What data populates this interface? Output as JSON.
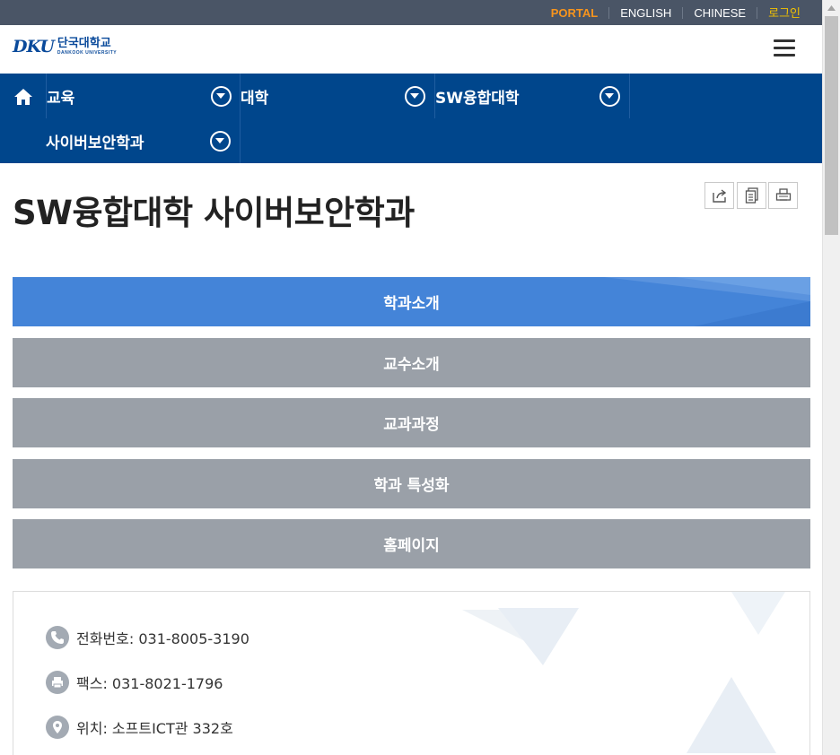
{
  "utility": {
    "portal": "PORTAL",
    "english": "ENGLISH",
    "chinese": "CHINESE",
    "login": "로그인"
  },
  "logo": {
    "mark": "DKU",
    "name_ko": "단국대학교",
    "name_en": "DANKOOK UNIVERSITY"
  },
  "nav": {
    "items": [
      {
        "label": "교육"
      },
      {
        "label": "대학"
      },
      {
        "label": "SW융합대학"
      },
      {
        "label": "사이버보안학과"
      }
    ]
  },
  "page": {
    "title": "SW융합대학 사이버보안학과"
  },
  "menu": {
    "items": [
      {
        "label": "학과소개",
        "active": true
      },
      {
        "label": "교수소개"
      },
      {
        "label": "교과과정"
      },
      {
        "label": "학과 특성화"
      },
      {
        "label": "홈페이지"
      }
    ]
  },
  "info": {
    "phone": "전화번호: 031-8005-3190",
    "fax": "팩스: 031-8021-1796",
    "location": "위치: 소프트ICT관 332호"
  },
  "icons": {
    "home": "home-icon",
    "share": "share-icon",
    "copy": "copy-icon",
    "print": "print-icon",
    "phone": "phone-icon",
    "fax": "fax-icon",
    "location": "location-icon",
    "menu": "hamburger-menu-icon"
  },
  "colors": {
    "utility_bar": "#4a5566",
    "portal": "#f7941d",
    "login": "#f2c200",
    "nav": "#00468c",
    "menu_active": "#4484d8",
    "menu_inactive": "#9aa0a8"
  }
}
